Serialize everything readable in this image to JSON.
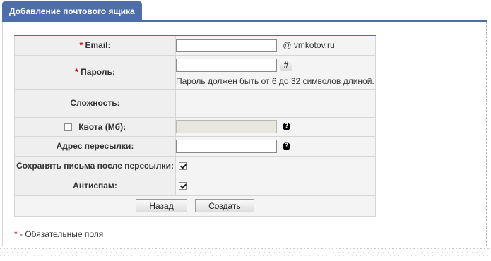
{
  "tab": {
    "title": "Добавление почтового ящика"
  },
  "form": {
    "email": {
      "required_mark": "*",
      "label": "Email:",
      "value": "",
      "domain": "@ vmkotov.ru"
    },
    "password": {
      "required_mark": "*",
      "label": "Пароль:",
      "value": "",
      "generate_label": "#",
      "hint": "Пароль должен быть от 6 до 32 символов длиной."
    },
    "complexity": {
      "label": "Сложность:"
    },
    "quota": {
      "label": "Квота (Мб):",
      "checked": false,
      "value": ""
    },
    "forward": {
      "label": "Адрес пересылки:",
      "value": ""
    },
    "keep_after_forward": {
      "label": "Сохранять письма после пересылки:",
      "checked": true
    },
    "antispam": {
      "label": "Антиспам:",
      "checked": true
    },
    "back_label": "Назад",
    "create_label": "Создать"
  },
  "footnote": {
    "mark": "*",
    "text": " - Обязательные поля"
  },
  "colors": {
    "accent": "#4d6ea8",
    "required": "#d40000"
  },
  "icons": {
    "help": "question-circle-icon",
    "checkbox": "checkbox-icon"
  }
}
